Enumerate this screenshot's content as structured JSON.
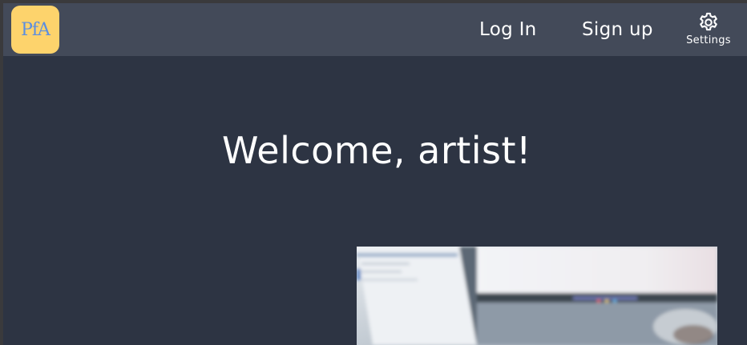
{
  "app": {
    "logo_text": "PfA",
    "brand_color": "#fdd36c",
    "logo_text_color": "#5b8ee0"
  },
  "nav": {
    "login_label": "Log In",
    "signup_label": "Sign up",
    "settings_label": "Settings",
    "settings_icon": "gear-icon",
    "background": "#434a59"
  },
  "main": {
    "welcome_title": "Welcome, artist!",
    "background": "#2d3443"
  },
  "hero": {
    "description": "blurred photo of a laptop and monitor on a desk",
    "image_icon": "photo"
  }
}
